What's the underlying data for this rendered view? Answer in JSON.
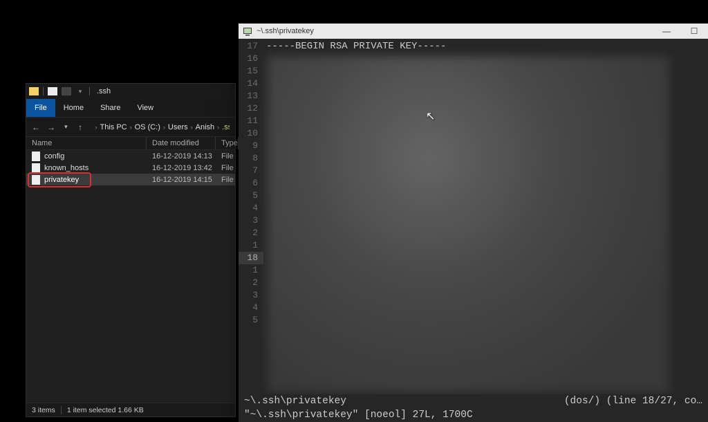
{
  "explorer": {
    "title": ".ssh",
    "tabs": {
      "file": "File",
      "home": "Home",
      "share": "Share",
      "view": "View"
    },
    "breadcrumbs": [
      "This PC",
      "OS (C:)",
      "Users",
      "Anish",
      ".ssh"
    ],
    "columns": {
      "name": "Name",
      "date": "Date modified",
      "type": "Type"
    },
    "files": [
      {
        "name": "config",
        "date": "16-12-2019 14:13",
        "type": "File",
        "selected": false
      },
      {
        "name": "known_hosts",
        "date": "16-12-2019 13:42",
        "type": "File",
        "selected": false
      },
      {
        "name": "privatekey",
        "date": "16-12-2019 14:15",
        "type": "File",
        "selected": true
      }
    ],
    "status": {
      "items": "3 items",
      "selected": "1 item selected  1.66 KB"
    }
  },
  "editor": {
    "title": "~\\.ssh\\privatekey",
    "first_line": "-----BEGIN RSA PRIVATE KEY-----",
    "line_numbers": [
      17,
      16,
      15,
      14,
      13,
      12,
      11,
      10,
      9,
      8,
      7,
      6,
      5,
      4,
      3,
      2,
      1,
      18,
      1,
      2,
      3,
      4,
      5
    ],
    "current_line_index": 17,
    "status_airline": {
      "path": "~\\.ssh\\privatekey",
      "right": "(dos/) (line 18/27, co…"
    },
    "status_vim": "\"~\\.ssh\\privatekey\" [noeol] 27L, 1700C"
  }
}
